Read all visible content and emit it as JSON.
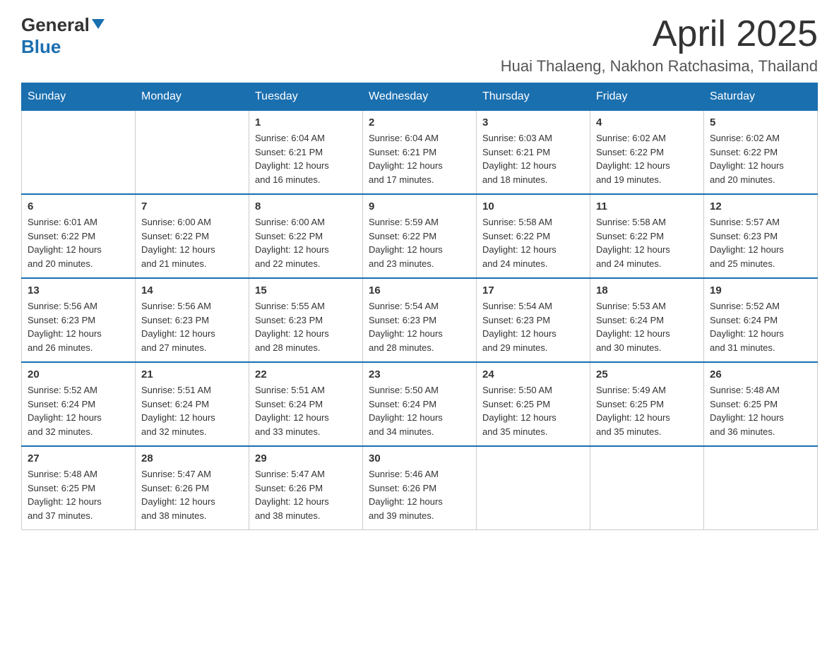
{
  "header": {
    "logo_general": "General",
    "logo_blue": "Blue",
    "month": "April 2025",
    "location": "Huai Thalaeng, Nakhon Ratchasima, Thailand"
  },
  "weekdays": [
    "Sunday",
    "Monday",
    "Tuesday",
    "Wednesday",
    "Thursday",
    "Friday",
    "Saturday"
  ],
  "weeks": [
    [
      {
        "day": "",
        "info": ""
      },
      {
        "day": "",
        "info": ""
      },
      {
        "day": "1",
        "info": "Sunrise: 6:04 AM\nSunset: 6:21 PM\nDaylight: 12 hours\nand 16 minutes."
      },
      {
        "day": "2",
        "info": "Sunrise: 6:04 AM\nSunset: 6:21 PM\nDaylight: 12 hours\nand 17 minutes."
      },
      {
        "day": "3",
        "info": "Sunrise: 6:03 AM\nSunset: 6:21 PM\nDaylight: 12 hours\nand 18 minutes."
      },
      {
        "day": "4",
        "info": "Sunrise: 6:02 AM\nSunset: 6:22 PM\nDaylight: 12 hours\nand 19 minutes."
      },
      {
        "day": "5",
        "info": "Sunrise: 6:02 AM\nSunset: 6:22 PM\nDaylight: 12 hours\nand 20 minutes."
      }
    ],
    [
      {
        "day": "6",
        "info": "Sunrise: 6:01 AM\nSunset: 6:22 PM\nDaylight: 12 hours\nand 20 minutes."
      },
      {
        "day": "7",
        "info": "Sunrise: 6:00 AM\nSunset: 6:22 PM\nDaylight: 12 hours\nand 21 minutes."
      },
      {
        "day": "8",
        "info": "Sunrise: 6:00 AM\nSunset: 6:22 PM\nDaylight: 12 hours\nand 22 minutes."
      },
      {
        "day": "9",
        "info": "Sunrise: 5:59 AM\nSunset: 6:22 PM\nDaylight: 12 hours\nand 23 minutes."
      },
      {
        "day": "10",
        "info": "Sunrise: 5:58 AM\nSunset: 6:22 PM\nDaylight: 12 hours\nand 24 minutes."
      },
      {
        "day": "11",
        "info": "Sunrise: 5:58 AM\nSunset: 6:22 PM\nDaylight: 12 hours\nand 24 minutes."
      },
      {
        "day": "12",
        "info": "Sunrise: 5:57 AM\nSunset: 6:23 PM\nDaylight: 12 hours\nand 25 minutes."
      }
    ],
    [
      {
        "day": "13",
        "info": "Sunrise: 5:56 AM\nSunset: 6:23 PM\nDaylight: 12 hours\nand 26 minutes."
      },
      {
        "day": "14",
        "info": "Sunrise: 5:56 AM\nSunset: 6:23 PM\nDaylight: 12 hours\nand 27 minutes."
      },
      {
        "day": "15",
        "info": "Sunrise: 5:55 AM\nSunset: 6:23 PM\nDaylight: 12 hours\nand 28 minutes."
      },
      {
        "day": "16",
        "info": "Sunrise: 5:54 AM\nSunset: 6:23 PM\nDaylight: 12 hours\nand 28 minutes."
      },
      {
        "day": "17",
        "info": "Sunrise: 5:54 AM\nSunset: 6:23 PM\nDaylight: 12 hours\nand 29 minutes."
      },
      {
        "day": "18",
        "info": "Sunrise: 5:53 AM\nSunset: 6:24 PM\nDaylight: 12 hours\nand 30 minutes."
      },
      {
        "day": "19",
        "info": "Sunrise: 5:52 AM\nSunset: 6:24 PM\nDaylight: 12 hours\nand 31 minutes."
      }
    ],
    [
      {
        "day": "20",
        "info": "Sunrise: 5:52 AM\nSunset: 6:24 PM\nDaylight: 12 hours\nand 32 minutes."
      },
      {
        "day": "21",
        "info": "Sunrise: 5:51 AM\nSunset: 6:24 PM\nDaylight: 12 hours\nand 32 minutes."
      },
      {
        "day": "22",
        "info": "Sunrise: 5:51 AM\nSunset: 6:24 PM\nDaylight: 12 hours\nand 33 minutes."
      },
      {
        "day": "23",
        "info": "Sunrise: 5:50 AM\nSunset: 6:24 PM\nDaylight: 12 hours\nand 34 minutes."
      },
      {
        "day": "24",
        "info": "Sunrise: 5:50 AM\nSunset: 6:25 PM\nDaylight: 12 hours\nand 35 minutes."
      },
      {
        "day": "25",
        "info": "Sunrise: 5:49 AM\nSunset: 6:25 PM\nDaylight: 12 hours\nand 35 minutes."
      },
      {
        "day": "26",
        "info": "Sunrise: 5:48 AM\nSunset: 6:25 PM\nDaylight: 12 hours\nand 36 minutes."
      }
    ],
    [
      {
        "day": "27",
        "info": "Sunrise: 5:48 AM\nSunset: 6:25 PM\nDaylight: 12 hours\nand 37 minutes."
      },
      {
        "day": "28",
        "info": "Sunrise: 5:47 AM\nSunset: 6:26 PM\nDaylight: 12 hours\nand 38 minutes."
      },
      {
        "day": "29",
        "info": "Sunrise: 5:47 AM\nSunset: 6:26 PM\nDaylight: 12 hours\nand 38 minutes."
      },
      {
        "day": "30",
        "info": "Sunrise: 5:46 AM\nSunset: 6:26 PM\nDaylight: 12 hours\nand 39 minutes."
      },
      {
        "day": "",
        "info": ""
      },
      {
        "day": "",
        "info": ""
      },
      {
        "day": "",
        "info": ""
      }
    ]
  ]
}
